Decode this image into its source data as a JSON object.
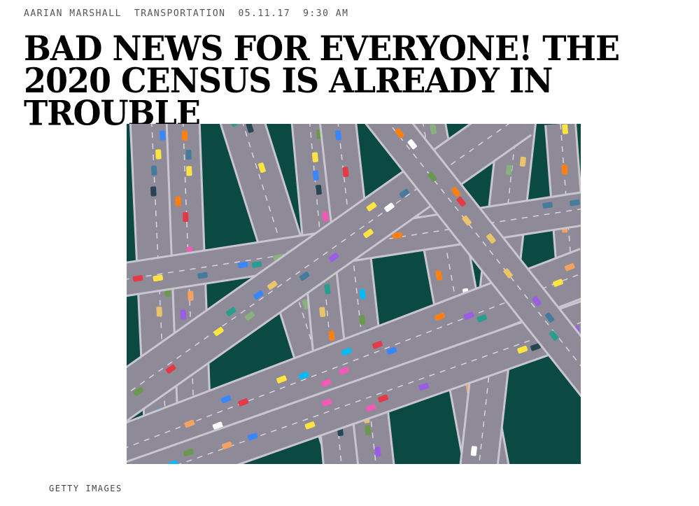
{
  "byline": {
    "author": "AARIAN MARSHALL",
    "section": "TRANSPORTATION",
    "date": "05.11.17",
    "time": "9:30 AM"
  },
  "article": {
    "headline": "BAD NEWS FOR EVERYONE! THE 2020 CENSUS IS ALREADY IN TROUBLE"
  },
  "hero_image": {
    "subject": "highway-interchange-illustration",
    "background_color": "#0b4a42",
    "road_color": "#8e8a98",
    "credit": "GETTY IMAGES"
  }
}
